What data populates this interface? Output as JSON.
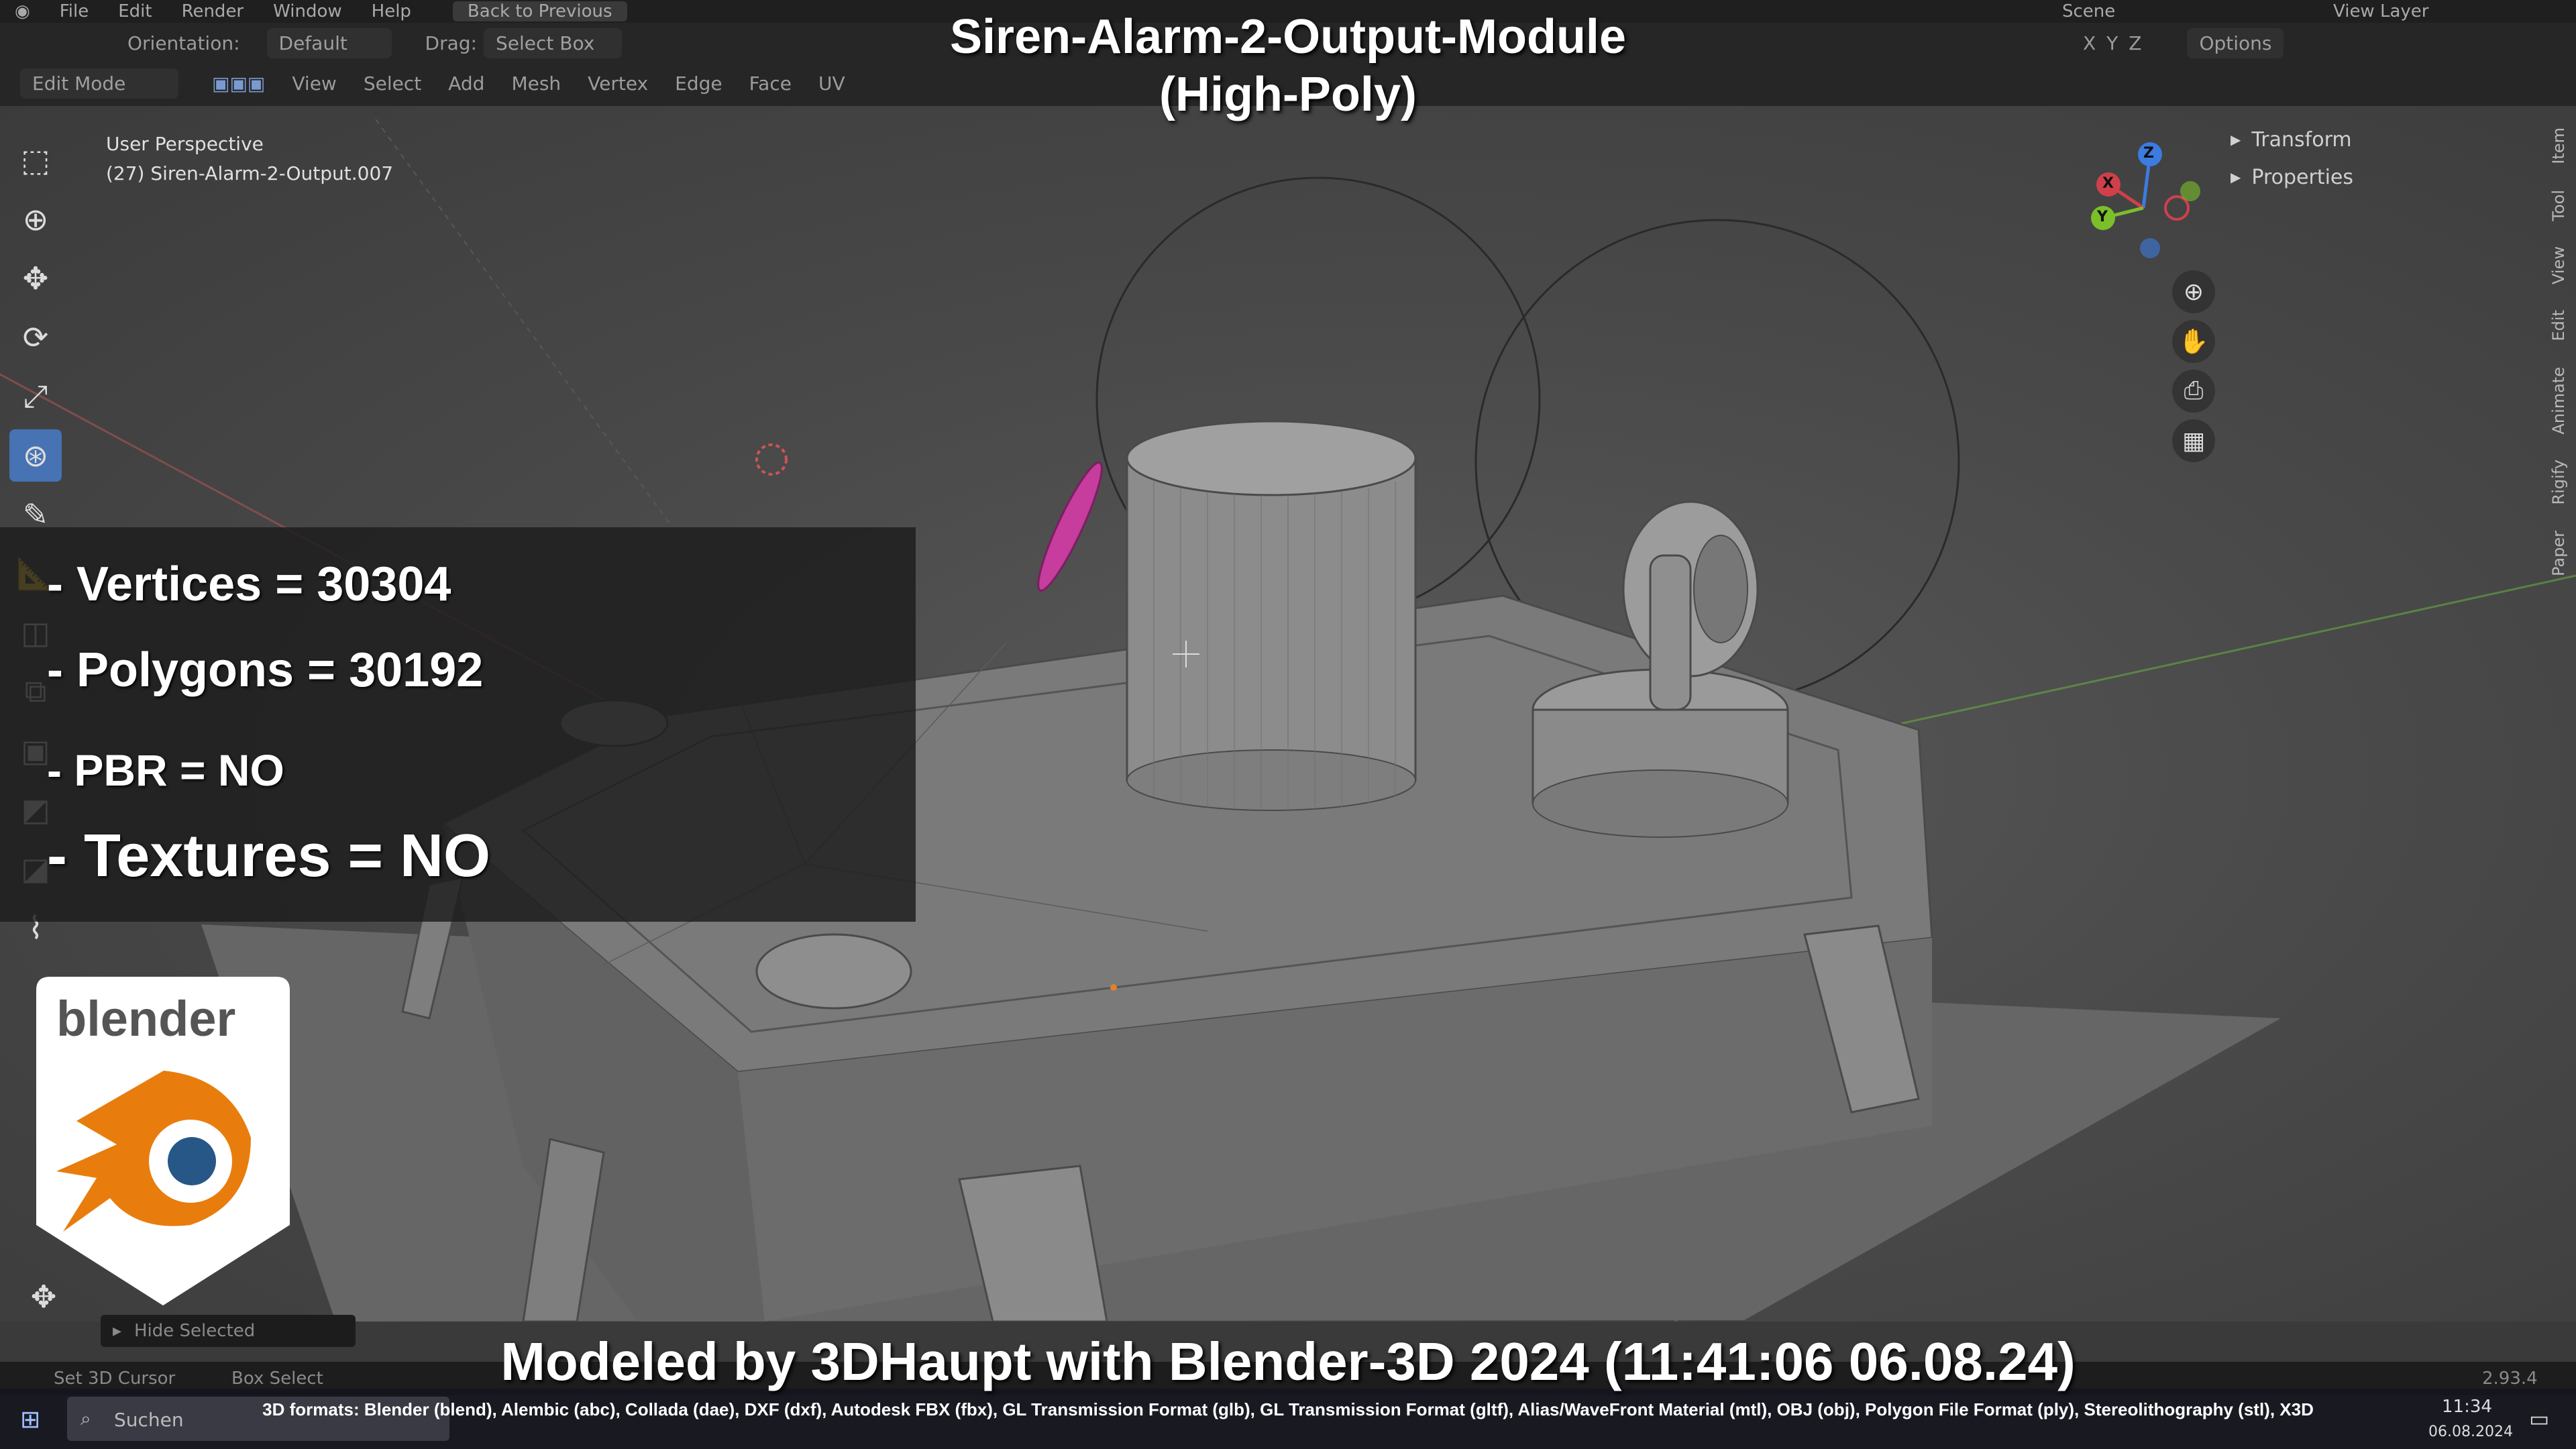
{
  "menu": [
    "File",
    "Edit",
    "Render",
    "Window",
    "Help"
  ],
  "back_to_previous": "Back to Previous",
  "scene_label": "Scene",
  "view_layer_label": "View Layer",
  "header": {
    "orientation_label": "Orientation:",
    "orientation_value": "Default",
    "drag_label": "Drag:",
    "drag_value": "Select Box",
    "options": "Options",
    "axes": [
      "X",
      "Y",
      "Z"
    ],
    "mode": "Edit Mode",
    "menus": [
      "View",
      "Select",
      "Add",
      "Mesh",
      "Vertex",
      "Edge",
      "Face",
      "UV"
    ]
  },
  "viewport": {
    "perspective": "User Perspective",
    "object": "(27) Siren-Alarm-2-Output.007"
  },
  "title_line1": "Siren-Alarm-2-Output-Module",
  "title_line2": "(High-Poly)",
  "stats": {
    "vertices": "- Vertices = 30304",
    "polygons": "- Polygons = 30192",
    "pbr": "- PBR =  NO",
    "textures": "- Textures = NO"
  },
  "logo_text": "blender",
  "npanel": {
    "transform": "Transform",
    "properties": "Properties"
  },
  "side_tabs": [
    "Item",
    "Tool",
    "View",
    "Edit",
    "Animate",
    "Rigify",
    "Paper"
  ],
  "gizmo_axes": [
    "Z",
    "X",
    "Y"
  ],
  "hide_selected": "Hide Selected",
  "credit": "Modeled by 3DHaupt with Blender-3D 2024 (11:41:06  06.08.24)",
  "formats": "3D formats: Blender (blend), Alembic (abc), Collada (dae), DXF (dxf), Autodesk FBX (fbx), GL Transmission Format (glb), GL Transmission Format (gltf), Alias/WaveFront Material (mtl), OBJ (obj), Polygon File Format (ply), Stereolithography (stl), X3D",
  "status": {
    "set_cursor": "Set 3D Cursor",
    "box_select": "Box Select",
    "version": "2.93.4"
  },
  "taskbar": {
    "search": "Suchen",
    "time": "11:34",
    "date": "06.08.2024"
  },
  "colors": {
    "accent": "#4772b3",
    "blender_orange": "#e87d0d",
    "blender_blue": "#265787"
  }
}
